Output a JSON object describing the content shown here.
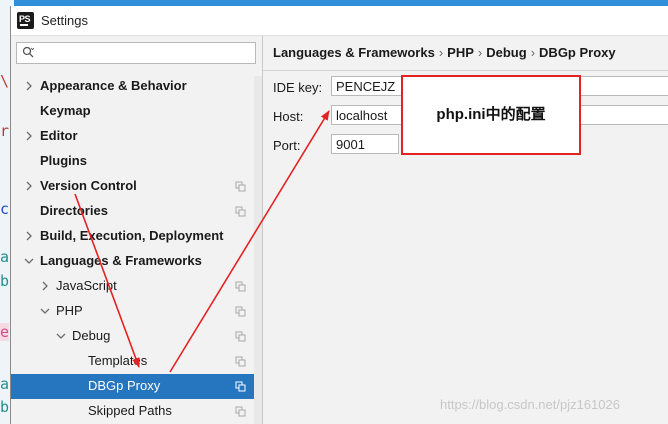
{
  "background_chars": [
    "\\",
    "r",
    "c",
    "a",
    "b",
    "e",
    "a",
    "b"
  ],
  "window": {
    "title": "Settings",
    "app_icon_text": "PS"
  },
  "search": {
    "placeholder": ""
  },
  "tree": [
    {
      "label": "Appearance & Behavior",
      "bold": true,
      "arrow": "right",
      "copy": false,
      "selected": false
    },
    {
      "label": "Keymap",
      "bold": true,
      "arrow": "",
      "copy": false,
      "selected": false
    },
    {
      "label": "Editor",
      "bold": true,
      "arrow": "right",
      "copy": false,
      "selected": false
    },
    {
      "label": "Plugins",
      "bold": true,
      "arrow": "",
      "copy": false,
      "selected": false
    },
    {
      "label": "Version Control",
      "bold": true,
      "arrow": "right",
      "copy": true,
      "selected": false
    },
    {
      "label": "Directories",
      "bold": true,
      "arrow": "",
      "copy": true,
      "selected": false
    },
    {
      "label": "Build, Execution, Deployment",
      "bold": true,
      "arrow": "right",
      "copy": false,
      "selected": false
    },
    {
      "label": "Languages & Frameworks",
      "bold": true,
      "arrow": "down",
      "copy": false,
      "selected": false
    },
    {
      "label": "JavaScript",
      "bold": false,
      "arrow": "right",
      "copy": true,
      "selected": false
    },
    {
      "label": "PHP",
      "bold": false,
      "arrow": "down",
      "copy": true,
      "selected": false
    },
    {
      "label": "Debug",
      "bold": false,
      "arrow": "down",
      "copy": true,
      "selected": false
    },
    {
      "label": "Templates",
      "bold": false,
      "arrow": "",
      "copy": true,
      "selected": false
    },
    {
      "label": "DBGp Proxy",
      "bold": false,
      "arrow": "",
      "copy": true,
      "selected": true
    },
    {
      "label": "Skipped Paths",
      "bold": false,
      "arrow": "",
      "copy": true,
      "selected": false
    }
  ],
  "breadcrumb": {
    "items": [
      "Languages & Frameworks",
      "PHP",
      "Debug",
      "DBGp Proxy"
    ],
    "separator": "›"
  },
  "form": {
    "ide_key_label": "IDE key:",
    "ide_key_value": "PENCEJZ",
    "host_label": "Host:",
    "host_value": "localhost",
    "port_label": "Port:",
    "port_value": "9001"
  },
  "annotation": {
    "text": "php.ini中的配置",
    "color": "#e52222"
  },
  "watermark": "https://blog.csdn.net/pjz161026",
  "colors": {
    "selection": "#2675bf",
    "desktop": "#2f8fd8",
    "arrow": "#e52222"
  }
}
